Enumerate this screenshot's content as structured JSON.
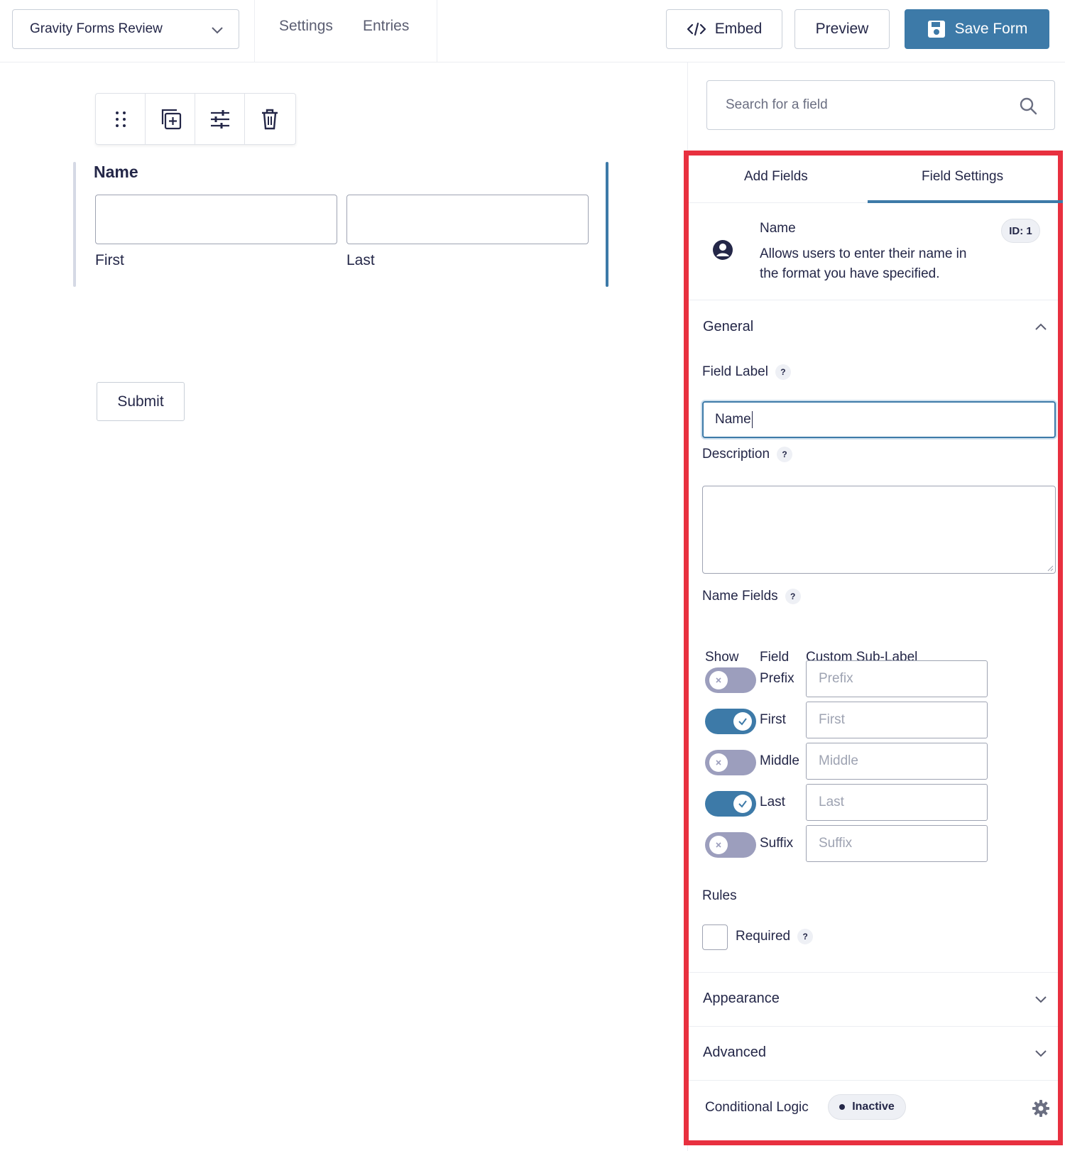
{
  "header": {
    "form_name": "Gravity Forms Review",
    "nav": [
      "Settings",
      "Entries"
    ],
    "embed_label": "Embed",
    "preview_label": "Preview",
    "save_label": "Save Form"
  },
  "canvas": {
    "field_title": "Name",
    "sub_labels": [
      "First",
      "Last"
    ],
    "submit_label": "Submit"
  },
  "sidebar": {
    "search_placeholder": "Search for a field",
    "tabs": [
      "Add Fields",
      "Field Settings"
    ],
    "active_tab": "Field Settings",
    "field_info": {
      "title": "Name",
      "description": "Allows users to enter their name in the format you have specified.",
      "id_badge": "ID: 1"
    },
    "general": {
      "title": "General",
      "field_label_label": "Field Label",
      "field_label_value": "Name",
      "description_label": "Description",
      "name_fields_label": "Name Fields",
      "columns": [
        "Show",
        "Field",
        "Custom Sub-Label"
      ],
      "rows": [
        {
          "field": "Prefix",
          "placeholder": "Prefix",
          "on": false
        },
        {
          "field": "First",
          "placeholder": "First",
          "on": true
        },
        {
          "field": "Middle",
          "placeholder": "Middle",
          "on": false
        },
        {
          "field": "Last",
          "placeholder": "Last",
          "on": true
        },
        {
          "field": "Suffix",
          "placeholder": "Suffix",
          "on": false
        }
      ],
      "rules_label": "Rules",
      "required_label": "Required",
      "help_glyph": "?"
    },
    "appearance_title": "Appearance",
    "advanced_title": "Advanced",
    "conditional_logic_label": "Conditional Logic",
    "conditional_logic_status": "Inactive"
  },
  "colors": {
    "accent": "#3d7aa8",
    "highlight_border": "#e8303f",
    "toggle_off": "#9c9ebd"
  }
}
